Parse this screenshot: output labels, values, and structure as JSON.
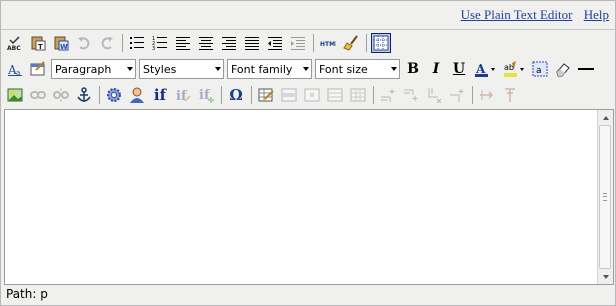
{
  "links": {
    "plain_text": "Use Plain Text Editor",
    "help": "Help"
  },
  "toolbar1": [
    {
      "name": "spellcheck-icon",
      "state": "on"
    },
    {
      "name": "paste-text-icon",
      "state": "on"
    },
    {
      "name": "paste-word-icon",
      "state": "on"
    },
    {
      "name": "undo-icon",
      "state": "disabled"
    },
    {
      "name": "redo-icon",
      "state": "disabled"
    },
    {
      "name": "bullet-list-icon",
      "state": "on"
    },
    {
      "name": "numbered-list-icon",
      "state": "on"
    },
    {
      "name": "align-left-icon",
      "state": "on"
    },
    {
      "name": "align-center-icon",
      "state": "on"
    },
    {
      "name": "align-right-icon",
      "state": "on"
    },
    {
      "name": "align-justify-icon",
      "state": "on"
    },
    {
      "name": "outdent-icon",
      "state": "on"
    },
    {
      "name": "indent-icon",
      "state": "disabled"
    },
    {
      "name": "html-source-icon",
      "state": "on"
    },
    {
      "name": "cleanup-icon",
      "state": "on"
    },
    {
      "name": "toggle-guidelines-icon",
      "state": "active"
    }
  ],
  "toolbar2": {
    "format": "Paragraph",
    "styles": "Styles",
    "font_family": "Font family",
    "font_size": "Font size",
    "bold": "B",
    "italic": "I",
    "underline": "U",
    "font_color": "A"
  },
  "toolbar3_glyphs": {
    "omega": "Ω",
    "if": "if"
  },
  "status": {
    "path": "Path: p"
  },
  "colors": {
    "link": "#1f3fa0",
    "background": "#f0f0ee",
    "active": "#c2cbe0"
  }
}
